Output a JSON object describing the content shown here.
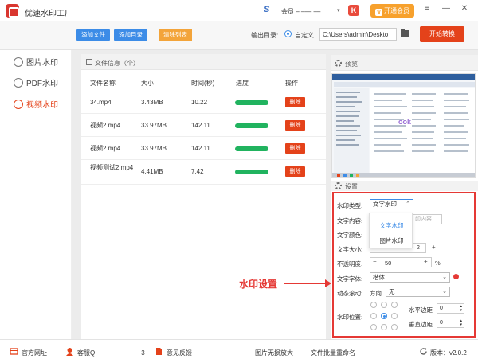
{
  "titlebar": {
    "app_name": "优速水印工厂",
    "member_text": "会员 – ––– ––",
    "dropdown": "▾",
    "red_icon": "K",
    "vip_label": "开通会员",
    "crown_glyph": "♛",
    "menu_glyph": "≡",
    "minimize_glyph": "—",
    "close_glyph": "✕"
  },
  "toolbar": {
    "add_file": "添加文件",
    "add_dir": "添加目录",
    "clear_list": "清除列表",
    "output_label": "输出目录:",
    "custom_label": "自定义",
    "output_path": "C:\\Users\\admin\\Deskto",
    "start": "开始转换"
  },
  "sidebar": {
    "items": [
      {
        "label": "图片水印",
        "active": false
      },
      {
        "label": "PDF水印",
        "active": false
      },
      {
        "label": "视频水印",
        "active": true
      }
    ]
  },
  "file_panel": {
    "title": "文件信息（个）",
    "columns": [
      "文件名称",
      "大小",
      "时间(秒)",
      "进度",
      "操作"
    ],
    "delete_label": "删除",
    "rows": [
      {
        "name": "34.mp4",
        "size": "3.43MB",
        "time": "10.22",
        "progress": 1.0
      },
      {
        "name": "视频2.mp4",
        "size": "33.97MB",
        "time": "142.11",
        "progress": 1.0
      },
      {
        "name": "视频2.mp4",
        "size": "33.97MB",
        "time": "142.11",
        "progress": 1.0
      },
      {
        "name": "视频测试2.mp4",
        "size": "4.41MB",
        "time": "7.42",
        "progress": 1.0
      }
    ]
  },
  "preview": {
    "title": "预览",
    "watermark_text": "ook"
  },
  "settings": {
    "title": "设置",
    "type_label": "水印类型:",
    "type_value": "文字水印",
    "type_options": [
      "文字水印",
      "图片水印"
    ],
    "content_label": "文字内容:",
    "content_placeholder": "印内容",
    "color_label": "文字颜色:",
    "size_label": "文字大小:",
    "size_value": "2",
    "opacity_label": "不透明度:",
    "opacity_value": "50",
    "opacity_unit": "%",
    "font_label": "文字字体:",
    "font_value": "楷体",
    "scroll_label": "动态滚动:",
    "scroll_dir_label": "方向",
    "scroll_value": "无",
    "position_label": "水印位置:",
    "h_margin_label": "水平边距",
    "h_margin_value": "0",
    "v_margin_label": "垂直边距",
    "v_margin_value": "0",
    "minus": "−",
    "plus": "+",
    "warn": "!"
  },
  "annotation": "水印设置",
  "footer": {
    "website": "官方网址",
    "service": "客服Q",
    "service_tail": "3",
    "feedback": "意见反馈",
    "image_enlarge": "图片无损放大",
    "batch_rename": "文件批量重命名",
    "version": "版本：v2.0.2"
  }
}
